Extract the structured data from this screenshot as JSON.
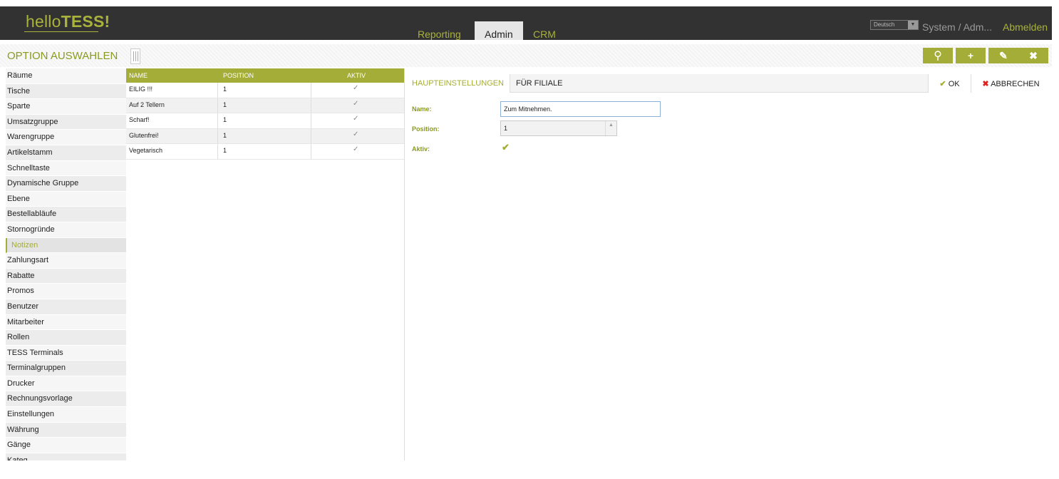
{
  "header": {
    "logo_light": "hello",
    "logo_bold": "TESS!",
    "nav": [
      "Reporting",
      "Admin",
      "CRM"
    ],
    "nav_active": "Admin",
    "language": "Deutsch",
    "user": "System / Adm...",
    "logout": "Abmelden"
  },
  "optionbar": {
    "title": "OPTION AUSWAHLEN",
    "tools": [
      {
        "name": "search-icon",
        "glyph": "⚲"
      },
      {
        "name": "plus-icon",
        "glyph": "+"
      },
      {
        "name": "edit-icon",
        "glyph": "✎"
      },
      {
        "name": "close-icon",
        "glyph": "✖"
      }
    ]
  },
  "sidebar": {
    "active": "Notizen",
    "items": [
      "Räume",
      "Tische",
      "Sparte",
      "Umsatzgruppe",
      "Warengruppe",
      "Artikelstamm",
      "Schnelltaste",
      "Dynamische Gruppe",
      "Ebene",
      "Bestellabläufe",
      "Stornogründe",
      "Notizen",
      "Zahlungsart",
      "Rabatte",
      "Promos",
      "Benutzer",
      "Mitarbeiter",
      "Rollen",
      "TESS Terminals",
      "Terminalgruppen",
      "Drucker",
      "Rechnungsvorlage",
      "Einstellungen",
      "Währung",
      "Gänge",
      "Kateg..."
    ]
  },
  "grid": {
    "columns": [
      "NAME",
      "POSITION",
      "AKTIV"
    ],
    "rows": [
      {
        "name": "EILIG !!!",
        "position": "1",
        "aktiv": true
      },
      {
        "name": "Auf 2 Tellern",
        "position": "1",
        "aktiv": true
      },
      {
        "name": "Scharf!",
        "position": "1",
        "aktiv": true
      },
      {
        "name": "Glutenfrei!",
        "position": "1",
        "aktiv": true
      },
      {
        "name": "Vegetarisch",
        "position": "1",
        "aktiv": true
      }
    ]
  },
  "detail": {
    "tabs": [
      "HAUPTEINSTELLUNGEN",
      "FÜR FILIALE"
    ],
    "active_tab": "HAUPTEINSTELLUNGEN",
    "ok_label": "OK",
    "cancel_label": "ABBRECHEN",
    "fields": {
      "name_label": "Name:",
      "name_value": "Zum Mitnehmen.",
      "position_label": "Position:",
      "position_value": "1",
      "aktiv_label": "Aktiv:",
      "aktiv_value": true
    }
  },
  "colors": {
    "accent": "#a4ad37",
    "header_bg": "#333232",
    "cancel": "#dd2222"
  }
}
